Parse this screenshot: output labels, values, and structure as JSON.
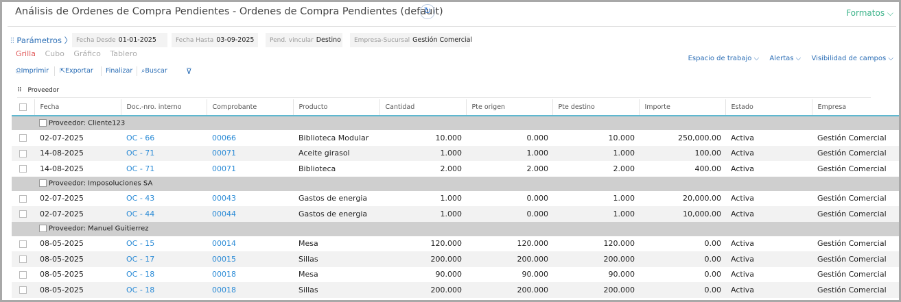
{
  "header": {
    "title": "Análisis de Ordenes de Compra Pendientes - Ordenes de Compra Pendientes (default)",
    "refresh_icon": "refresh-icon",
    "formatos_label": "Formatos ⌵"
  },
  "params": {
    "link_label": "Parámetros 〉",
    "chips": [
      {
        "label": "Fecha Desde",
        "value": "01-01-2025"
      },
      {
        "label": "Fecha Hasta",
        "value": "03-09-2025"
      },
      {
        "label": "Pend. vincular",
        "value": "Destino"
      },
      {
        "label": "Empresa-Sucursal",
        "value": "Gestión Comercial"
      }
    ]
  },
  "views": {
    "tabs": [
      "Grilla",
      "Cubo",
      "Gráfico",
      "Tablero"
    ],
    "active": "Grilla"
  },
  "right_menus": [
    "Espacio de trabajo ⌵",
    "Alertas ⌵",
    "Visibilidad de campos ⌵"
  ],
  "toolbar": {
    "imprimir": "Imprimir",
    "exportar": "Exportar",
    "finalizar": "Finalizar",
    "buscar": "Buscar"
  },
  "grouping": {
    "label": "Proveedor"
  },
  "table": {
    "columns": [
      "Fecha",
      "Doc.-nro. interno",
      "Comprobante",
      "Producto",
      "Cantidad",
      "Pte origen",
      "Pte destino",
      "Importe",
      "Estado",
      "Empresa"
    ],
    "groups": [
      {
        "label": "Proveedor: Cliente123",
        "rows": [
          [
            "02-07-2025",
            "OC - 66",
            "00066",
            "Biblioteca Modular",
            "10.000",
            "0.000",
            "10.000",
            "250,000.00",
            "Activa",
            "Gestión Comercial"
          ],
          [
            "14-08-2025",
            "OC - 71",
            "00071",
            "Aceite girasol",
            "1.000",
            "1.000",
            "1.000",
            "100.00",
            "Activa",
            "Gestión Comercial"
          ],
          [
            "14-08-2025",
            "OC - 71",
            "00071",
            "Biblioteca",
            "2.000",
            "2.000",
            "2.000",
            "400.00",
            "Activa",
            "Gestión Comercial"
          ]
        ]
      },
      {
        "label": "Proveedor: Imposoluciones SA",
        "rows": [
          [
            "02-07-2025",
            "OC - 43",
            "00043",
            "Gastos de energia",
            "1.000",
            "0.000",
            "1.000",
            "20,000.00",
            "Activa",
            "Gestión Comercial"
          ],
          [
            "02-07-2025",
            "OC - 44",
            "00044",
            "Gastos de energia",
            "1.000",
            "0.000",
            "1.000",
            "10,000.00",
            "Activa",
            "Gestión Comercial"
          ]
        ]
      },
      {
        "label": "Proveedor: Manuel Guitierrez",
        "rows": [
          [
            "08-05-2025",
            "OC - 15",
            "00014",
            "Mesa",
            "120.000",
            "120.000",
            "120.000",
            "0.00",
            "Activa",
            "Gestión Comercial"
          ],
          [
            "08-05-2025",
            "OC - 17",
            "00015",
            "Sillas",
            "200.000",
            "200.000",
            "200.000",
            "0.00",
            "Activa",
            "Gestión Comercial"
          ],
          [
            "08-05-2025",
            "OC - 18",
            "00018",
            "Mesa",
            "90.000",
            "90.000",
            "90.000",
            "0.00",
            "Activa",
            "Gestión Comercial"
          ],
          [
            "08-05-2025",
            "OC - 18",
            "00018",
            "Sillas",
            "200.000",
            "200.000",
            "200.000",
            "0.00",
            "Activa",
            "Gestión Comercial"
          ]
        ]
      }
    ]
  },
  "colors": {
    "accent": "#2a6db5",
    "link": "#2b8bd6",
    "active_tab": "#e05a5a",
    "formatos": "#3cb38a"
  }
}
